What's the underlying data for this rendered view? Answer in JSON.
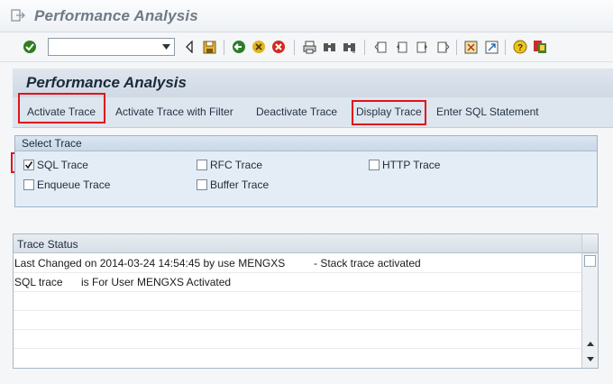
{
  "window": {
    "title": "Performance Analysis"
  },
  "toolbar": {
    "command_field": {
      "value": "",
      "placeholder": ""
    },
    "icons": [
      "enter-checkmark-icon",
      "command-dropdown-icon",
      "back-triangle-icon",
      "save-icon",
      "back-green-icon",
      "exit-yellow-icon",
      "cancel-red-icon",
      "print-icon",
      "find-icon",
      "find-next-icon",
      "first-page-icon",
      "previous-page-icon",
      "next-page-icon",
      "last-page-icon",
      "create-session-icon",
      "shortcut-icon",
      "help-icon",
      "customize-layout-icon"
    ]
  },
  "app": {
    "header": "Performance Analysis",
    "buttons": {
      "activate_trace": "Activate Trace",
      "activate_trace_filter": "Activate Trace with Filter",
      "deactivate_trace": "Deactivate Trace",
      "display_trace": "Display Trace",
      "enter_sql": "Enter SQL Statement"
    }
  },
  "select_trace": {
    "title": "Select Trace",
    "options": {
      "sql": {
        "label": "SQL Trace",
        "checked": true
      },
      "rfc": {
        "label": "RFC Trace",
        "checked": false
      },
      "http": {
        "label": "HTTP Trace",
        "checked": false
      },
      "enqueue": {
        "label": "Enqueue Trace",
        "checked": false
      },
      "buffer": {
        "label": "Buffer Trace",
        "checked": false
      }
    }
  },
  "trace_status": {
    "title": "Trace Status",
    "rows": [
      {
        "col1": "Last Changed on 2014-03-24 14:54:45 by use MENGXS",
        "col2": "- Stack trace activated"
      },
      {
        "col1": "SQL trace",
        "col2": "is For User MENGXS Activated"
      }
    ]
  },
  "colors": {
    "highlight": "#e0131b",
    "header_bg": "#cfd9e4"
  }
}
